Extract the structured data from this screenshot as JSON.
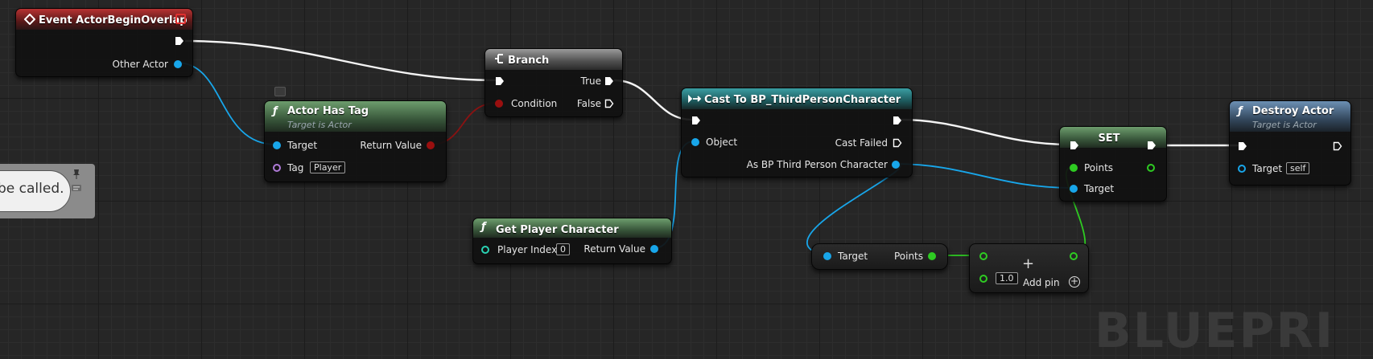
{
  "comment": {
    "text": "be called.",
    "trailing": "."
  },
  "watermark": "BLUEPRI",
  "nodes": {
    "event": {
      "title": "Event ActorBeginOverlap",
      "pins": {
        "other_actor": "Other Actor"
      }
    },
    "has_tag": {
      "title": "Actor Has Tag",
      "subtitle": "Target is Actor",
      "pins": {
        "target": "Target",
        "return_value": "Return Value",
        "tag": "Tag",
        "tag_value": "Player"
      }
    },
    "branch": {
      "title": "Branch",
      "pins": {
        "true": "True",
        "condition": "Condition",
        "false": "False"
      }
    },
    "cast": {
      "title": "Cast To BP_ThirdPersonCharacter",
      "pins": {
        "object": "Object",
        "cast_failed": "Cast Failed",
        "as_bp": "As BP Third Person Character"
      }
    },
    "get_player": {
      "title": "Get Player Character",
      "pins": {
        "player_index": "Player Index",
        "player_index_value": "0",
        "return_value": "Return Value"
      }
    },
    "points_getter": {
      "pins": {
        "target": "Target",
        "points": "Points"
      }
    },
    "add": {
      "symbol": "+",
      "value": "1.0",
      "add_pin": "Add pin"
    },
    "set": {
      "title": "SET",
      "pins": {
        "points": "Points",
        "target": "Target"
      }
    },
    "destroy": {
      "title": "Destroy Actor",
      "subtitle": "Target is Actor",
      "pins": {
        "target": "Target",
        "target_value": "self"
      }
    }
  },
  "colors": {
    "object_pin": "#18a6ea",
    "bool_pin": "#9a0f0f",
    "float_pin": "#2ecb22",
    "exec_wire": "#ffffff"
  },
  "icons": {
    "event": "event-diamond-icon",
    "branch": "branch-icon",
    "cast": "cast-arrow-icon",
    "function": "function-icon",
    "comment_pin": "pin-icon"
  }
}
